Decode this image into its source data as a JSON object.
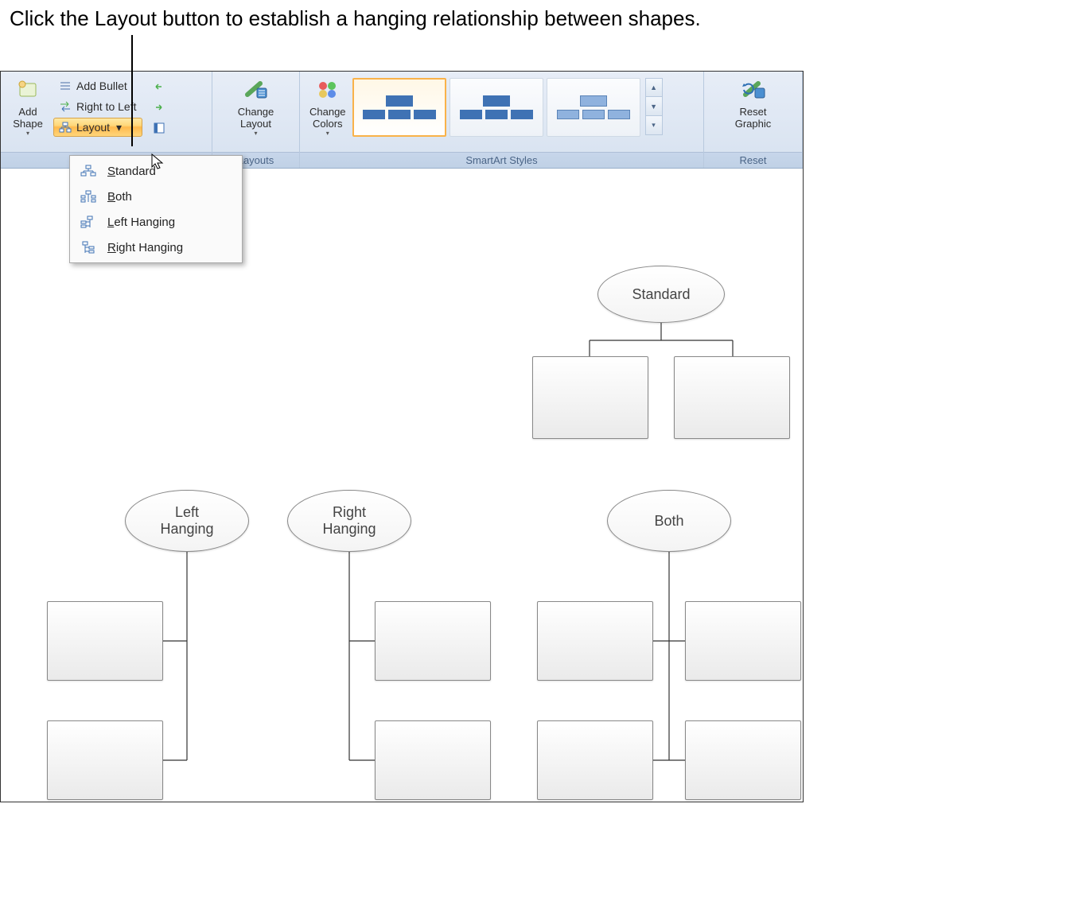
{
  "caption": "Click the Layout button to establish a hanging relationship between shapes.",
  "ribbon": {
    "create_graphic": {
      "add_shape": "Add\nShape",
      "add_bullet": "Add Bullet",
      "right_to_left": "Right to Left",
      "layout": "Layout"
    },
    "layouts": {
      "change_layout": "Change\nLayout",
      "group": "Layouts"
    },
    "styles": {
      "change_colors": "Change\nColors",
      "group": "SmartArt Styles"
    },
    "reset": {
      "reset_graphic": "Reset\nGraphic",
      "group": "Reset"
    }
  },
  "layout_menu": {
    "items": [
      {
        "label": "Standard",
        "key": "S"
      },
      {
        "label": "Both",
        "key": "B"
      },
      {
        "label": "Left Hanging",
        "key": "L"
      },
      {
        "label": "Right Hanging",
        "key": "R"
      }
    ]
  },
  "diagrams": {
    "standard": "Standard",
    "left_hanging": "Left\nHanging",
    "right_hanging": "Right\nHanging",
    "both": "Both"
  }
}
